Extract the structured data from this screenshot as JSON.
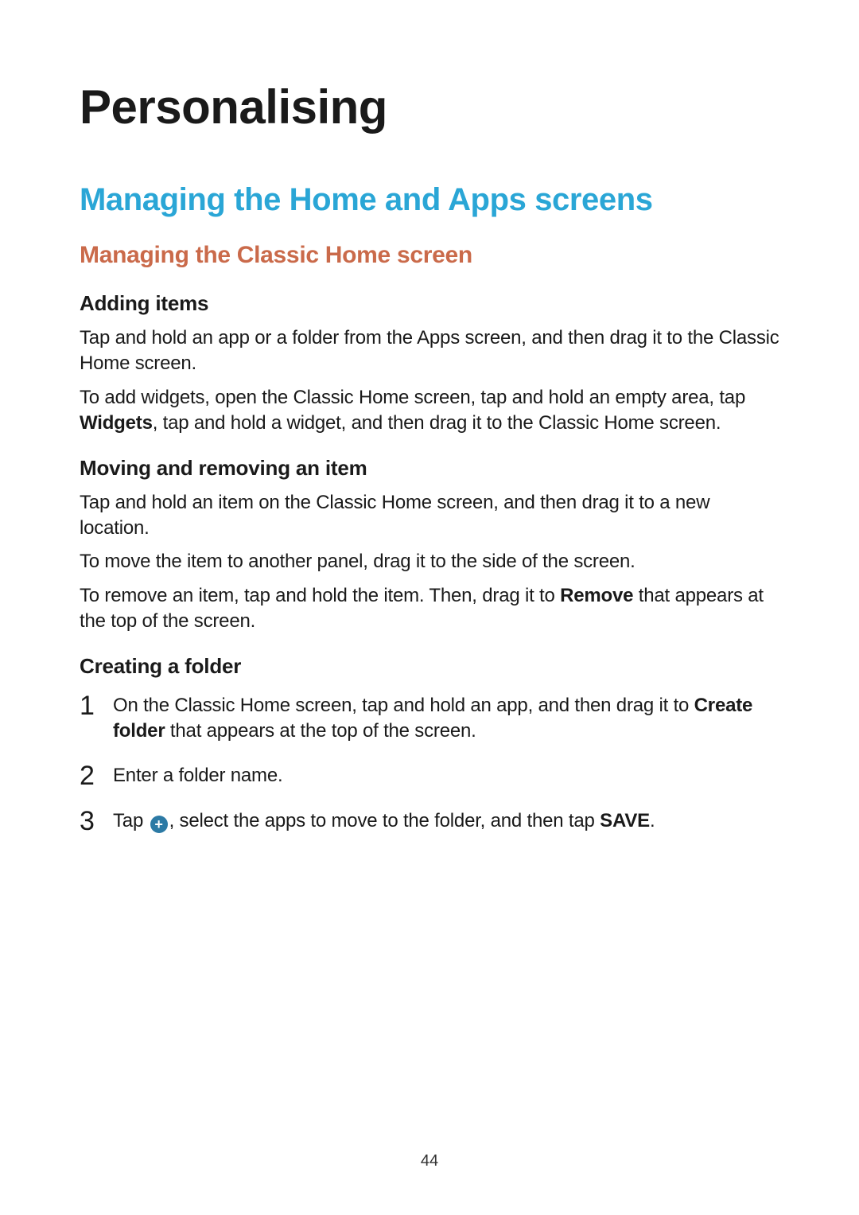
{
  "page_number": "44",
  "h1": "Personalising",
  "h2": "Managing the Home and Apps screens",
  "h3": "Managing the Classic Home screen",
  "adding_items": {
    "heading": "Adding items",
    "p1": "Tap and hold an app or a folder from the Apps screen, and then drag it to the Classic Home screen.",
    "p2_before": "To add widgets, open the Classic Home screen, tap and hold an empty area, tap ",
    "p2_bold": "Widgets",
    "p2_after": ", tap and hold a widget, and then drag it to the Classic Home screen."
  },
  "moving": {
    "heading": "Moving and removing an item",
    "p1": "Tap and hold an item on the Classic Home screen, and then drag it to a new location.",
    "p2": "To move the item to another panel, drag it to the side of the screen.",
    "p3_before": "To remove an item, tap and hold the item. Then, drag it to ",
    "p3_bold": "Remove",
    "p3_after": " that appears at the top of the screen."
  },
  "creating_folder": {
    "heading": "Creating a folder",
    "step1_before": "On the Classic Home screen, tap and hold an app, and then drag it to ",
    "step1_bold": "Create folder",
    "step1_after": " that appears at the top of the screen.",
    "step2": "Enter a folder name.",
    "step3_before": "Tap ",
    "step3_icon_label": "+",
    "step3_mid": ", select the apps to move to the folder, and then tap ",
    "step3_bold": "SAVE",
    "step3_after": "."
  }
}
